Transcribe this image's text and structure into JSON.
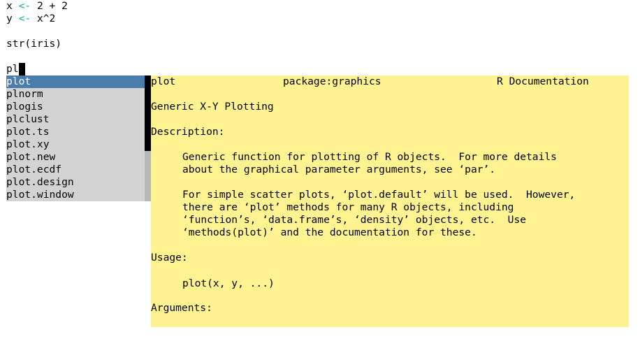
{
  "editor": {
    "line1": {
      "a": "x",
      "op": "<-",
      "b": "2 + 2"
    },
    "line2": {
      "a": "y",
      "op": "<-",
      "b": "x^2"
    },
    "line3": "str(iris)",
    "typed": "pl"
  },
  "completions": {
    "items": [
      "plot",
      "plnorm",
      "plogis",
      "plclust",
      "plot.ts",
      "plot.xy",
      "plot.new",
      "plot.ecdf",
      "plot.design",
      "plot.window"
    ],
    "selected_index": 0
  },
  "doc": {
    "header_name": "plot",
    "header_package": "package:graphics",
    "header_source": "R Documentation",
    "title": "Generic X-Y Plotting",
    "description_heading": "Description:",
    "description_p1_l1": "Generic function for plotting of R objects.  For more details",
    "description_p1_l2": "about the graphical parameter arguments, see ‘par’.",
    "description_p2_l1": "For simple scatter plots, ‘plot.default’ will be used.  However,",
    "description_p2_l2": "there are ‘plot’ methods for many R objects, including",
    "description_p2_l3": "‘function’s, ‘data.frame’s, ‘density’ objects, etc.  Use",
    "description_p2_l4": "‘methods(plot)’ and the documentation for these.",
    "usage_heading": "Usage:",
    "usage_code": "plot(x, y, ...)",
    "arguments_heading": "Arguments:"
  },
  "colors": {
    "operator": "#1aa3a3",
    "selection": "#4a7dab",
    "popup_bg": "#d3d3d3",
    "doc_bg": "#fff291"
  }
}
